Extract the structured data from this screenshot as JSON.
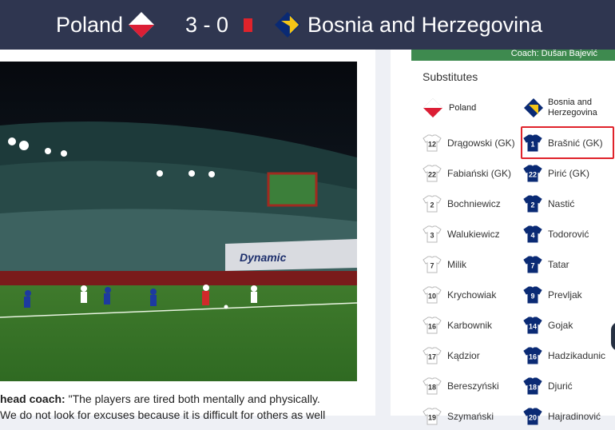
{
  "match": {
    "home_team": "Poland",
    "away_team": "Bosnia and Herzegovina",
    "score": "3 - 0",
    "colors": {
      "header_bg": "#2f3650",
      "red_card": "#e0232b",
      "poland_red": "#dc1e35",
      "bosnia_blue": "#0a2a74",
      "bosnia_yellow": "#f4c517"
    }
  },
  "photo": {
    "billboard_text": "Dynamic"
  },
  "article": {
    "caption_lead": "head coach:",
    "caption_text": " \"The players are tired both mentally and physically.",
    "caption_line2": "We do not look for excuses because it is difficult for others as well"
  },
  "lineups": {
    "coach_label": "Coach: Dušan Bajević",
    "substitutes_title": "Substitutes",
    "home_label": "Poland",
    "away_label_line1": "Bosnia and",
    "away_label_line2": "Herzegovina",
    "home": [
      {
        "number": "12",
        "name": "Drągowski (GK)"
      },
      {
        "number": "22",
        "name": "Fabiański (GK)"
      },
      {
        "number": "2",
        "name": "Bochniewicz"
      },
      {
        "number": "3",
        "name": "Walukiewicz"
      },
      {
        "number": "7",
        "name": "Milik"
      },
      {
        "number": "10",
        "name": "Krychowiak"
      },
      {
        "number": "16",
        "name": "Karbownik"
      },
      {
        "number": "17",
        "name": "Kądzior"
      },
      {
        "number": "18",
        "name": "Bereszyński"
      },
      {
        "number": "19",
        "name": "Szymański"
      }
    ],
    "away": [
      {
        "number": "1",
        "name": "Brašnić (GK)"
      },
      {
        "number": "22",
        "name": "Pirić (GK)"
      },
      {
        "number": "2",
        "name": "Nastić"
      },
      {
        "number": "4",
        "name": "Todorović"
      },
      {
        "number": "7",
        "name": "Tatar"
      },
      {
        "number": "9",
        "name": "Prevljak"
      },
      {
        "number": "14",
        "name": "Gojak"
      },
      {
        "number": "16",
        "name": "Hadzikadunic"
      },
      {
        "number": "18",
        "name": "Djurić"
      },
      {
        "number": "20",
        "name": "Hajradinović"
      }
    ]
  }
}
